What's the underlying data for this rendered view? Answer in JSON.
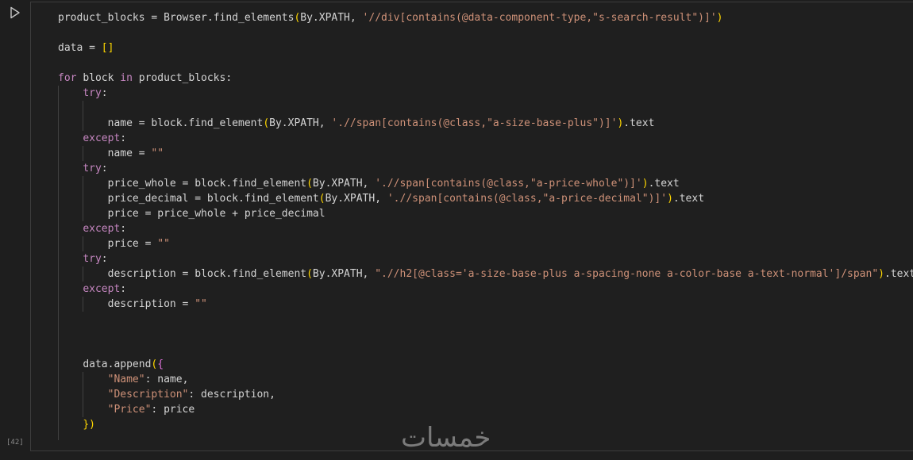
{
  "cell": {
    "execution_count": "[42]",
    "run_icon": "play-icon",
    "watermark": "خمسات"
  },
  "code": {
    "lines": [
      "product_blocks = Browser.find_elements(By.XPATH, '//div[contains(@data-component-type,\"s-search-result\")]')",
      "",
      "data = []",
      "",
      "for block in product_blocks:",
      "    try:",
      "",
      "        name = block.find_element(By.XPATH, './/span[contains(@class,\"a-size-base-plus\")]').text",
      "    except:",
      "        name = \"\"",
      "    try:",
      "        price_whole = block.find_element(By.XPATH, './/span[contains(@class,\"a-price-whole\")]').text",
      "        price_decimal = block.find_element(By.XPATH, './/span[contains(@class,\"a-price-decimal\")]').text",
      "        price = price_whole + price_decimal",
      "    except:",
      "        price = \"\"",
      "    try:",
      "        description = block.find_element(By.XPATH, \".//h2[@class='a-size-base-plus a-spacing-none a-color-base a-text-normal']/span\").text",
      "    except:",
      "        description = \"\"",
      "",
      "",
      "",
      "    data.append({",
      "        \"Name\": name,",
      "        \"Description\": description,",
      "        \"Price\": price",
      "    })"
    ]
  },
  "colors": {
    "background": "#1e1e1e",
    "text": "#d4d4d4",
    "keyword": "#c586c0",
    "string": "#ce9178",
    "bracket_level1": "#ffd700",
    "bracket_level2": "#da70d6"
  }
}
